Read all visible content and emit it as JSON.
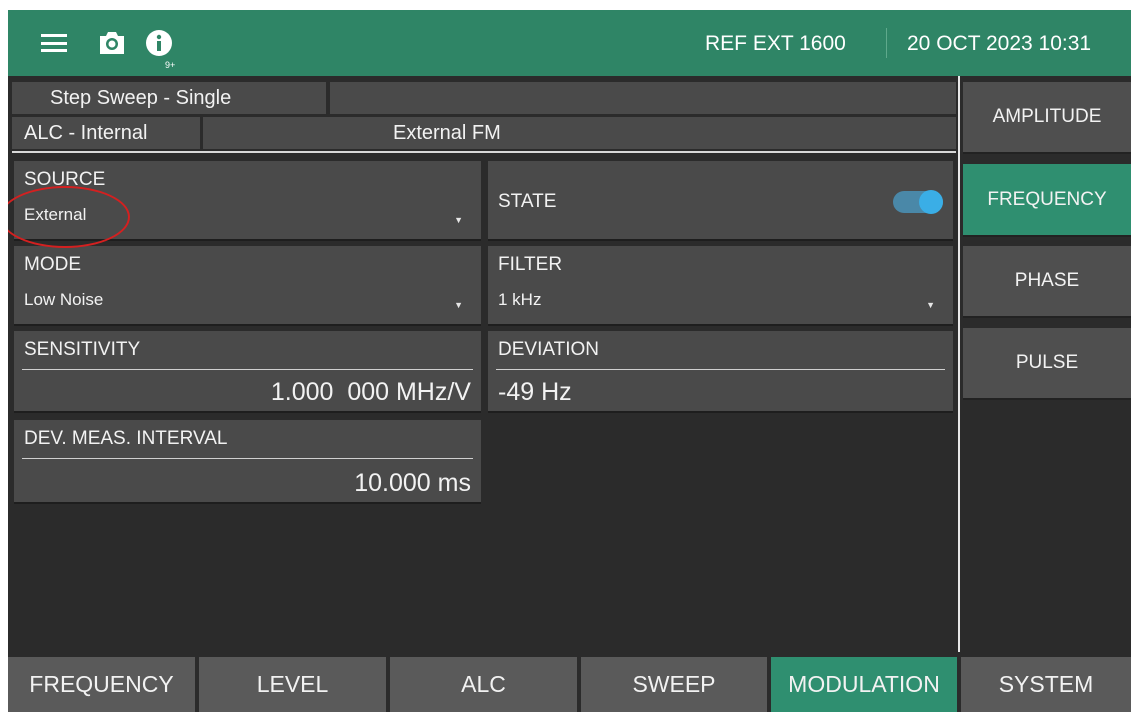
{
  "header": {
    "menu_icon": "hamburger-menu-icon",
    "camera_icon": "camera-icon",
    "info_icon": "info-icon",
    "info_badge": "9+",
    "reference": "REF EXT 1600",
    "datetime": "20 OCT 2023 10:31"
  },
  "status": {
    "sweep_mode": "Step Sweep - Single",
    "alc_mode": "ALC - Internal",
    "modulation_status": "External FM"
  },
  "params": {
    "source": {
      "label": "SOURCE",
      "value": "External"
    },
    "state": {
      "label": "STATE",
      "on": true
    },
    "mode": {
      "label": "MODE",
      "value": "Low Noise"
    },
    "filter": {
      "label": "FILTER",
      "value": "1 kHz"
    },
    "sensitivity": {
      "label": "SENSITIVITY",
      "value": "1.000  000 MHz/V"
    },
    "deviation": {
      "label": "DEVIATION",
      "value": "-49 Hz"
    },
    "interval": {
      "label": "DEV. MEAS. INTERVAL",
      "value": "10.000 ms"
    }
  },
  "side_menu": {
    "amplitude": "AMPLITUDE",
    "frequency": "FREQUENCY",
    "phase": "PHASE",
    "pulse": "PULSE",
    "active": "FREQUENCY"
  },
  "tabs": {
    "frequency": "FREQUENCY",
    "level": "LEVEL",
    "alc": "ALC",
    "sweep": "SWEEP",
    "modulation": "MODULATION",
    "system": "SYSTEM",
    "active": "MODULATION"
  },
  "colors": {
    "accent_green": "#2f8f70",
    "header_green": "#2f8566",
    "toggle_blue": "#3aaee6",
    "annotation_red": "#d42020"
  }
}
